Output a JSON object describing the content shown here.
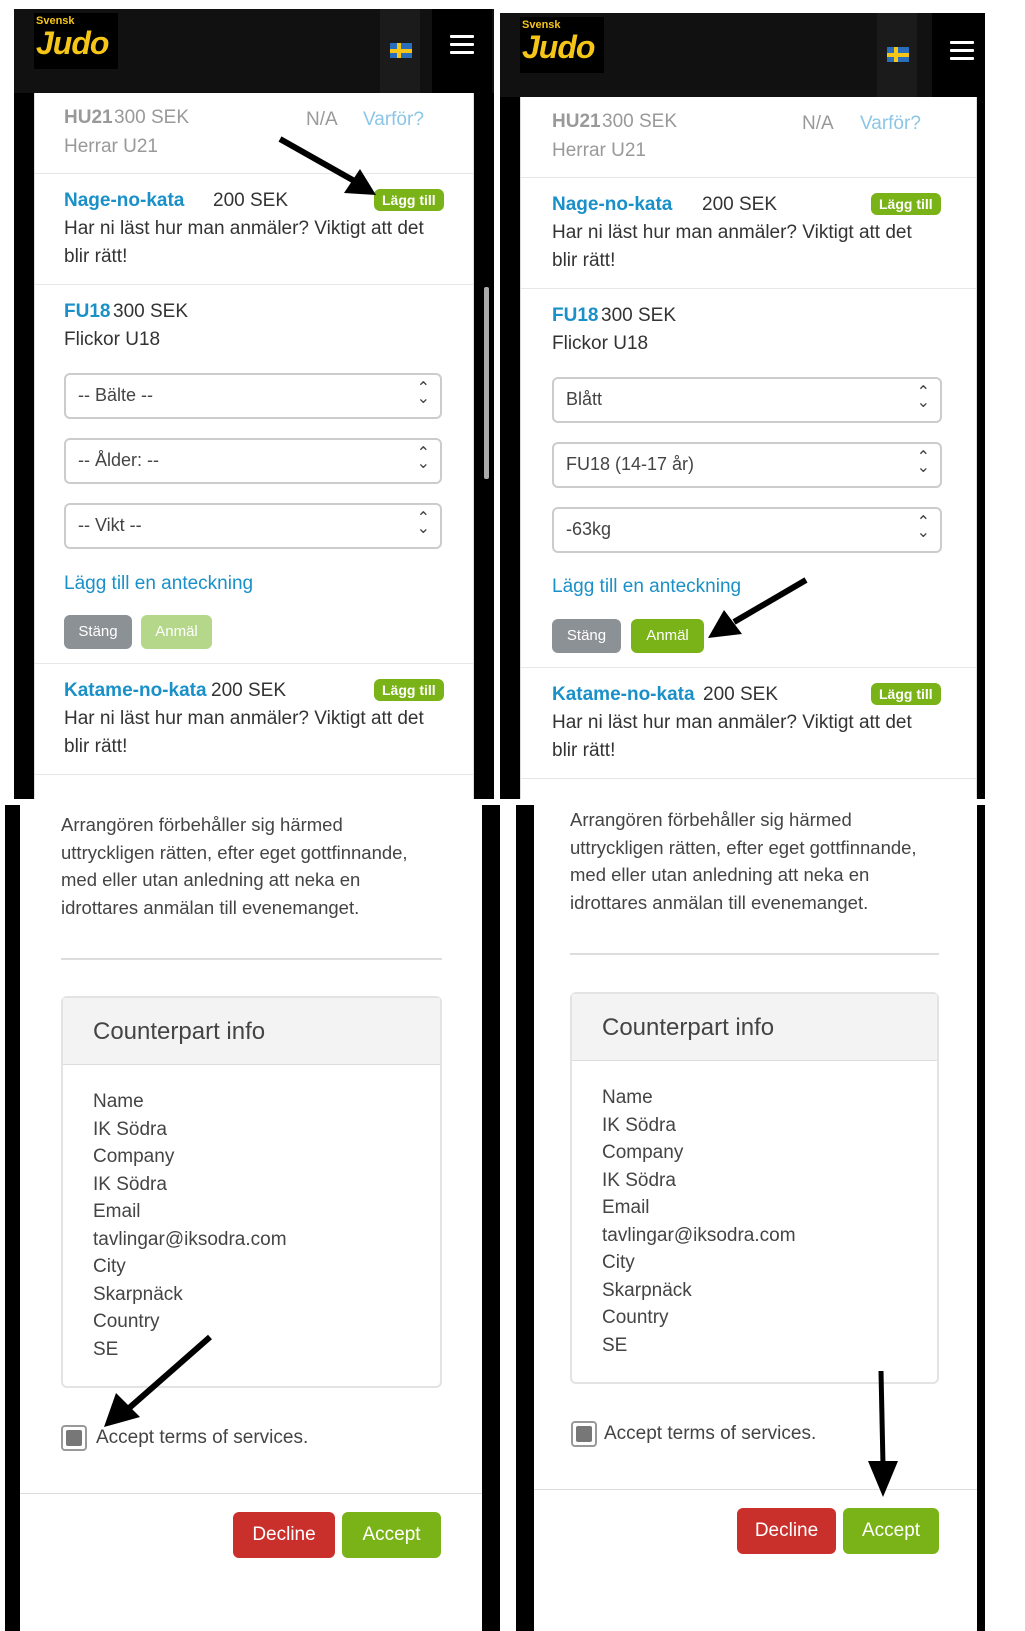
{
  "brand": {
    "top": "Svensk",
    "main": "Judo"
  },
  "icons": {
    "flag": "swedish-flag-icon",
    "menu": "hamburger-menu-icon",
    "select": "chevron-updown-icon"
  },
  "colors": {
    "accent_green": "#7ab317",
    "link_blue": "#1a90c8",
    "decline_red": "#c9302c",
    "gray_button": "#8c9196"
  },
  "hu21": {
    "code": "HU21",
    "price": "300 SEK",
    "status": "N/A",
    "why": "Varför?",
    "desc": "Herrar U21"
  },
  "nage": {
    "name": "Nage-no-kata",
    "price": "200 SEK",
    "add": "Lägg till",
    "desc_line1": "Har ni läst hur man anmäler? Viktigt att det",
    "desc_line2": "blir rätt!"
  },
  "fu18": {
    "code": "FU18",
    "price": "300 SEK",
    "desc": "Flickor U18"
  },
  "katame": {
    "name": "Katame-no-kata",
    "price": "200 SEK",
    "add": "Lägg till",
    "desc_line1": "Har ni läst hur man anmäler? Viktigt att det",
    "desc_line2": "blir rätt!"
  },
  "form_before": {
    "belt": "-- Bälte --",
    "age": "-- Ålder: --",
    "weight": "-- Vikt --"
  },
  "form_after": {
    "belt": "Blått",
    "age": "FU18 (14-17 år)",
    "weight": "-63kg"
  },
  "note_link": "Lägg till en anteckning",
  "close_label": "Stäng",
  "register_label": "Anmäl",
  "policy_lines": [
    "Arrangören förbehåller sig härmed",
    "uttryckligen rätten, efter eget gottfinnande,",
    "med eller utan anledning att neka en",
    "idrottares anmälan till evenemanget."
  ],
  "counterpart": {
    "title": "Counterpart info",
    "rows": [
      "Name",
      "IK Södra",
      "Company",
      "IK Södra",
      "Email",
      "tavlingar@iksodra.com",
      "City",
      "Skarpnäck",
      "Country",
      "SE"
    ]
  },
  "terms_label": "Accept terms of services.",
  "decline_label": "Decline",
  "accept_label": "Accept"
}
